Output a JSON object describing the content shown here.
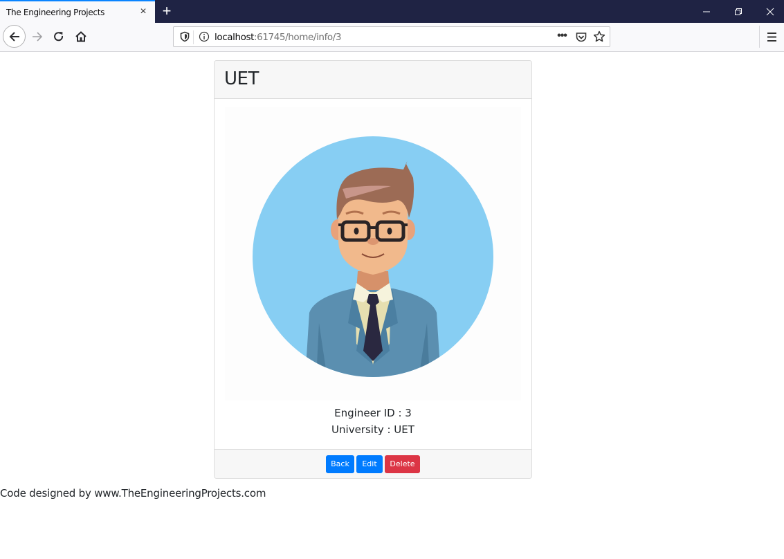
{
  "browser": {
    "tab_title": "The Engineering Projects",
    "tab_close_icon": "×",
    "new_tab_icon": "+",
    "url_host": "localhost",
    "url_rest": ":61745/home/info/3",
    "more_icon": "•••"
  },
  "card": {
    "header_title": "UET",
    "avatar_alt": "Engineer avatar illustration",
    "engineer_id_line": "Engineer ID : 3",
    "university_line": "University : UET",
    "buttons": {
      "back": "Back",
      "edit": "Edit",
      "delete": "Delete"
    }
  },
  "footer": {
    "text": "Code designed by www.TheEngineeringProjects.com"
  },
  "colors": {
    "primary": "#007bff",
    "danger": "#dc3545",
    "titlebar": "#1f2344",
    "avatar_bg": "#87cef3"
  }
}
